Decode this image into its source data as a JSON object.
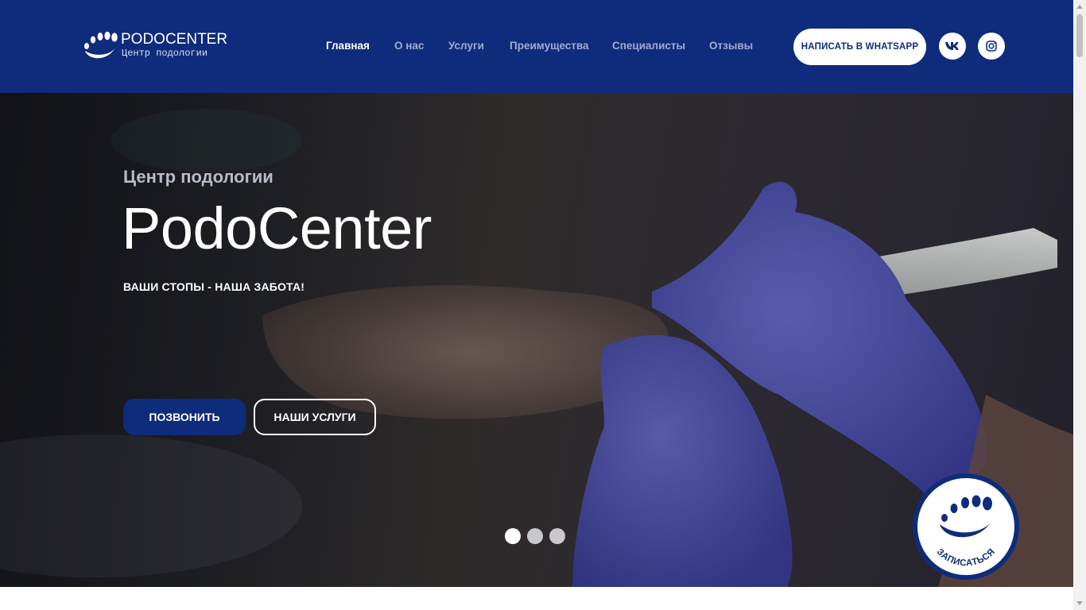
{
  "header": {
    "logo": {
      "title": "PODOCENTER",
      "subtitle": "Центр подологии"
    },
    "nav": [
      {
        "label": "Главная",
        "active": true
      },
      {
        "label": "О нас",
        "active": false
      },
      {
        "label": "Услуги",
        "active": false
      },
      {
        "label": "Преимущества",
        "active": false
      },
      {
        "label": "Специалисты",
        "active": false
      },
      {
        "label": "Отзывы",
        "active": false
      }
    ],
    "whatsapp_label": "НАПИСАТЬ В WHATSAPP",
    "social": [
      {
        "icon": "vk-icon"
      },
      {
        "icon": "instagram-icon"
      }
    ]
  },
  "hero": {
    "kicker": "Центр подологии",
    "title": "PodoCenter",
    "tagline": "ВАШИ СТОПЫ - НАША ЗАБОТА!",
    "call_label": "ПОЗВОНИТЬ",
    "services_label": "НАШИ УСЛУГИ",
    "slides": {
      "count": 3,
      "active_index": 0
    }
  },
  "book_badge": {
    "label": "ЗАПИСАТЬСЯ"
  },
  "colors": {
    "brand": "#0f2c7c",
    "nav_inactive": "#9fabcf",
    "glove": "#5b5ec4"
  }
}
